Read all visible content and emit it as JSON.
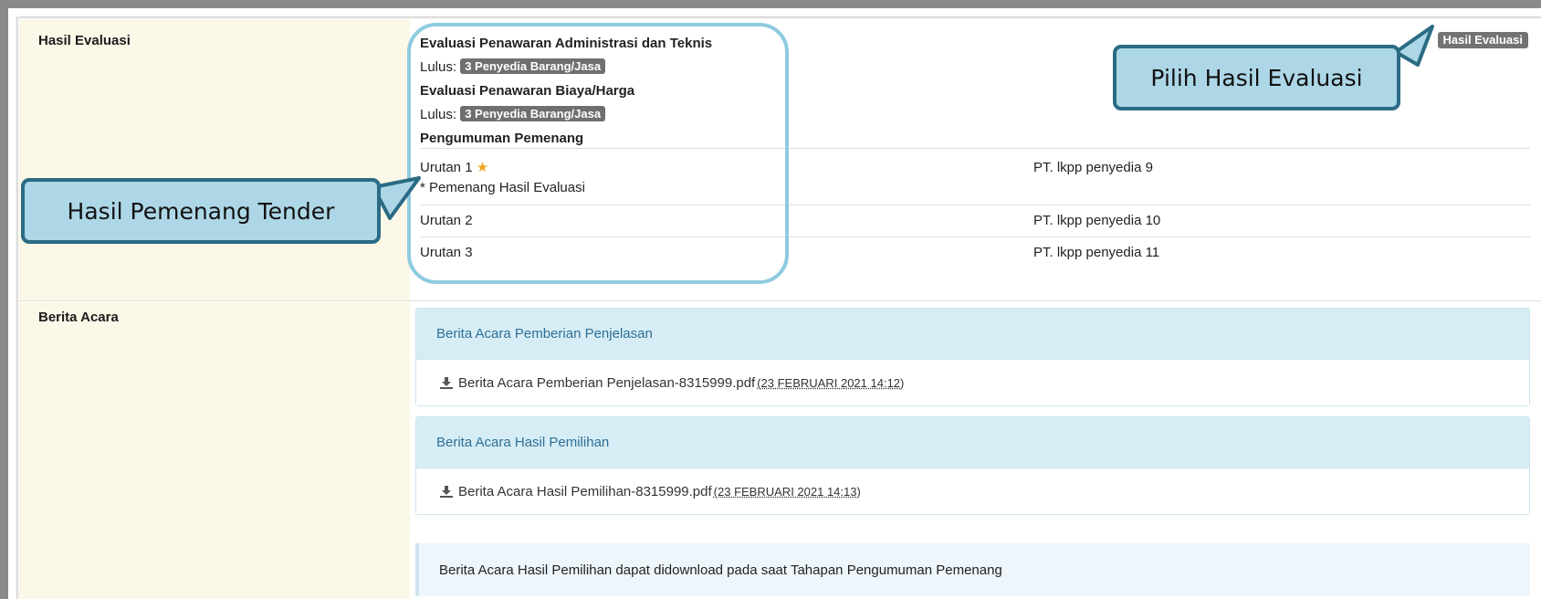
{
  "hasil_evaluasi": {
    "label": "Hasil Evaluasi",
    "button_label": "Hasil Evaluasi",
    "admin_teknis_title": "Evaluasi Penawaran Administrasi dan Teknis",
    "lulus_label_1": "Lulus:",
    "lulus_badge_1": "3 Penyedia Barang/Jasa",
    "biaya_title": "Evaluasi Penawaran Biaya/Harga",
    "lulus_label_2": "Lulus:",
    "lulus_badge_2": "3 Penyedia Barang/Jasa",
    "pengumuman_title": "Pengumuman Pemenang",
    "ranks": [
      {
        "rank": "Urutan 1",
        "note": "* Pemenang Hasil Evaluasi",
        "name": "PT. lkpp penyedia 9"
      },
      {
        "rank": "Urutan 2",
        "name": "PT. lkpp penyedia 10"
      },
      {
        "rank": "Urutan 3",
        "name": "PT. lkpp penyedia 11"
      }
    ]
  },
  "berita_acara": {
    "label": "Berita Acara",
    "panels": [
      {
        "title": "Berita Acara Pemberian Penjelasan",
        "file": "Berita Acara Pemberian Penjelasan-8315999.pdf",
        "timestamp": "(23 FEBRUARI 2021 14:12)"
      },
      {
        "title": "Berita Acara Hasil Pemilihan",
        "file": "Berita Acara Hasil Pemilihan-8315999.pdf",
        "timestamp": "(23 FEBRUARI 2021 14:13)"
      }
    ],
    "info": "Berita Acara Hasil Pemilihan dapat didownload pada saat Tahapan Pengumuman Pemenang"
  },
  "callouts": {
    "pilih": "Pilih Hasil Evaluasi",
    "pemenang": "Hasil Pemenang Tender"
  },
  "colors": {
    "label_bg": "#fbf8e8",
    "panel_head_bg": "#d7edf6",
    "callout_bg": "#add7e7",
    "callout_border": "#2b6b84",
    "star": "#f0a523"
  }
}
